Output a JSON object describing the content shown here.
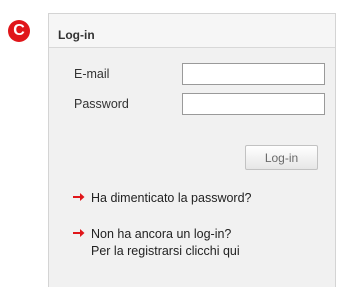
{
  "badge": {
    "letter": "C"
  },
  "panel": {
    "title": "Log-in",
    "email_label": "E-mail",
    "email_value": "",
    "password_label": "Password",
    "password_value": "",
    "login_button_label": "Log-in",
    "forgot_link": "Ha dimenticato la password?",
    "register_line1": "Non ha ancora un log-in?",
    "register_line2": "Per la registrarsi clicchi qui",
    "arrow_icon": "arrow-right-icon"
  },
  "colors": {
    "accent": "#e0161a",
    "panel_bg": "#f1f1f1",
    "border": "#d4d4d4"
  }
}
